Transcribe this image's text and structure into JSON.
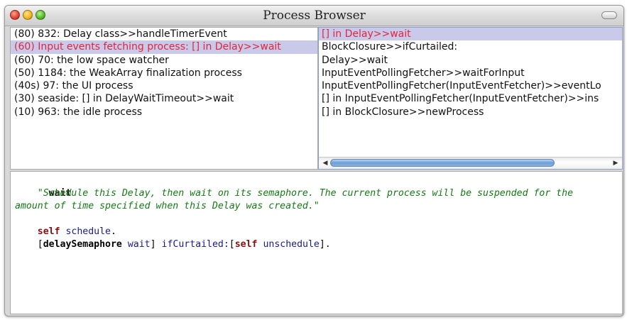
{
  "window": {
    "title": "Process Browser"
  },
  "process_list": {
    "items": [
      {
        "label": "(80)   832: Delay class>>handleTimerEvent",
        "selected": false
      },
      {
        "label": "(60) Input events fetching process: [] in Delay>>wait",
        "selected": true
      },
      {
        "label": "(60)    70: the low space watcher",
        "selected": false
      },
      {
        "label": "(50)  1184: the WeakArray finalization process",
        "selected": false
      },
      {
        "label": "(40s)    97: the UI process",
        "selected": false
      },
      {
        "label": "(30) seaside: [] in DelayWaitTimeout>>wait",
        "selected": false
      },
      {
        "label": "(10)   963: the idle process",
        "selected": false
      }
    ]
  },
  "stack_list": {
    "items": [
      {
        "label": "[] in Delay>>wait",
        "selected": true
      },
      {
        "label": "BlockClosure>>ifCurtailed:",
        "selected": false
      },
      {
        "label": "Delay>>wait",
        "selected": false
      },
      {
        "label": "InputEventPollingFetcher>>waitForInput",
        "selected": false
      },
      {
        "label": "InputEventPollingFetcher(InputEventFetcher)>>eventLo",
        "selected": false
      },
      {
        "label": "[] in InputEventPollingFetcher(InputEventFetcher)>>ins",
        "selected": false
      },
      {
        "label": "[] in BlockClosure>>newProcess",
        "selected": false
      }
    ]
  },
  "code": {
    "method_name": "wait",
    "comment_line1": "\"Schedule this Delay, then wait on its semaphore. The current process will be suspended for the",
    "comment_line2": "amount of time specified when this Delay was created.\"",
    "self_kw": "self",
    "schedule_msg": "schedule",
    "period": ".",
    "open_bracket": "[",
    "delay_semaphore": "delaySemaphore",
    "wait_msg": "wait",
    "close_bracket": "]",
    "if_curtailed": "ifCurtailed:",
    "unschedule_msg": "unschedule",
    "final_close": "]."
  },
  "colors": {
    "selection_bg": "#c9c9ea",
    "selection_text": "#e1263b",
    "comment": "#157a15",
    "keyword": "#8a1010",
    "message": "#1a1a8a"
  }
}
